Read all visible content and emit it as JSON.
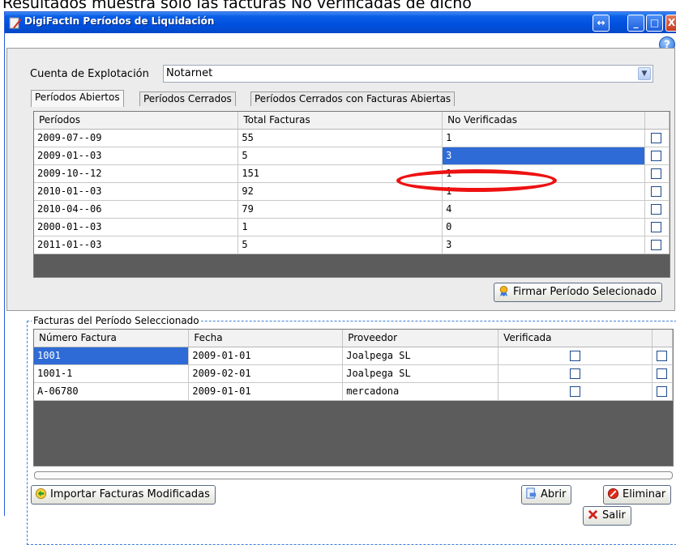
{
  "caption": "Resultados muestra solo las facturas No verificadas de dicho",
  "window": {
    "title": "DigiFactIn Períodos de Liquidación",
    "buttons": {
      "resize": "↔",
      "minimize": "_",
      "maximize": "□",
      "close": "X"
    }
  },
  "help_label": "?",
  "account": {
    "label": "Cuenta de Explotación",
    "value": "Notarnet"
  },
  "tabs": [
    {
      "label": "Períodos Abiertos",
      "active": true
    },
    {
      "label": "Períodos Cerrados",
      "active": false
    },
    {
      "label": "Períodos Cerrados con Facturas Abiertas",
      "active": false
    }
  ],
  "periods_table": {
    "columns": [
      "Períodos",
      "Total Facturas",
      "No Verificadas",
      ""
    ],
    "rows": [
      {
        "period": "2009-07--09",
        "total": "55",
        "unverified": "1",
        "checked": false
      },
      {
        "period": "2009-01--03",
        "total": "5",
        "unverified": "3",
        "checked": false,
        "selected": true
      },
      {
        "period": "2009-10--12",
        "total": "151",
        "unverified": "1",
        "checked": false
      },
      {
        "period": "2010-01--03",
        "total": "92",
        "unverified": "1",
        "checked": false
      },
      {
        "period": "2010-04--06",
        "total": "79",
        "unverified": "4",
        "checked": false
      },
      {
        "period": "2000-01--03",
        "total": "1",
        "unverified": "0",
        "checked": false
      },
      {
        "period": "2011-01--03",
        "total": "5",
        "unverified": "3",
        "checked": false
      }
    ]
  },
  "sign_button": "Firmar Período Selecionado",
  "invoices": {
    "legend": "Facturas del Período Seleccionado",
    "columns": [
      "Número Factura",
      "Fecha",
      "Proveedor",
      "Verificada",
      ""
    ],
    "rows": [
      {
        "number": "1001",
        "date": "2009-01-01",
        "supplier": "Joalpega SL",
        "verified": false,
        "checked": false,
        "selected": true
      },
      {
        "number": "1001-1",
        "date": "2009-02-01",
        "supplier": "Joalpega SL",
        "verified": false,
        "checked": false
      },
      {
        "number": "A-06780",
        "date": "2009-01-01",
        "supplier": "mercadona",
        "verified": false,
        "checked": false
      }
    ]
  },
  "buttons": {
    "import": "Importar Facturas Modificadas",
    "open": "Abrir",
    "delete": "Eliminar",
    "exit": "Salir"
  },
  "colors": {
    "titlebar": "#0050de",
    "selection": "#2f6bd6",
    "annotation": "#ee1111"
  }
}
